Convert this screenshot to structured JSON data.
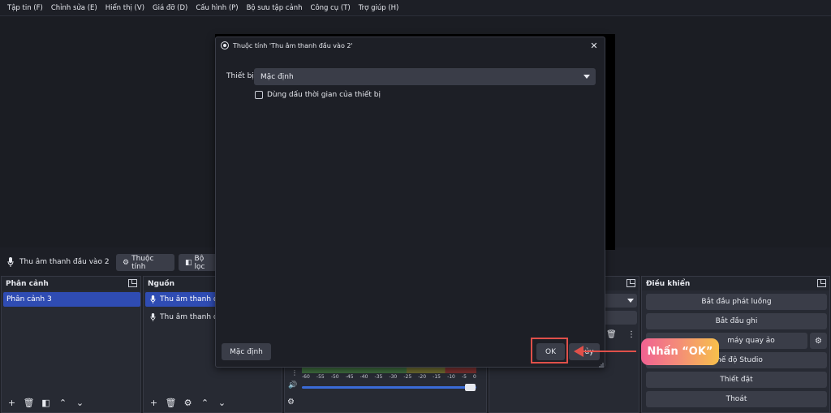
{
  "menu": [
    "Tập tin (F)",
    "Chỉnh sửa (E)",
    "Hiển thị (V)",
    "Giá đỡ (D)",
    "Cấu hình (P)",
    "Bộ sưu tập cảnh",
    "Công cụ (T)",
    "Trợ giúp (H)"
  ],
  "source_toolbar": {
    "source_name": "Thu âm thanh đầu vào 2",
    "properties_label": "Thuộc tính",
    "filters_label": "Bộ lọc"
  },
  "scenes_dock": {
    "title": "Phân cảnh",
    "items": [
      "Phân cảnh 3"
    ]
  },
  "sources_dock": {
    "title": "Nguồn",
    "items": [
      "Thu âm thanh đầu",
      "Thu âm thanh đầu"
    ]
  },
  "mixer": {
    "ticks": [
      "-60",
      "-55",
      "-50",
      "-45",
      "-40",
      "-35",
      "-30",
      "-25",
      "-20",
      "-15",
      "-10",
      "-5",
      "0"
    ]
  },
  "controls_dock": {
    "title": "Điều khiển",
    "buttons": [
      "Bắt đầu phát luồng",
      "Bắt đầu ghi",
      "máy quay ảo",
      "hế độ Studio",
      "Thiết đặt",
      "Thoát"
    ]
  },
  "dialog": {
    "title": "Thuộc tính 'Thu âm thanh đầu vào 2'",
    "device_label": "Thiết bị",
    "device_value": "Mặc định",
    "timestamp_checkbox": "Dùng dấu thời gian của thiết bị",
    "default_button": "Mặc định",
    "ok_button": "OK",
    "cancel_button_partial": "ủy"
  },
  "annotation": {
    "callout_text": "Nhấn “OK”",
    "color": "#e0504a"
  }
}
